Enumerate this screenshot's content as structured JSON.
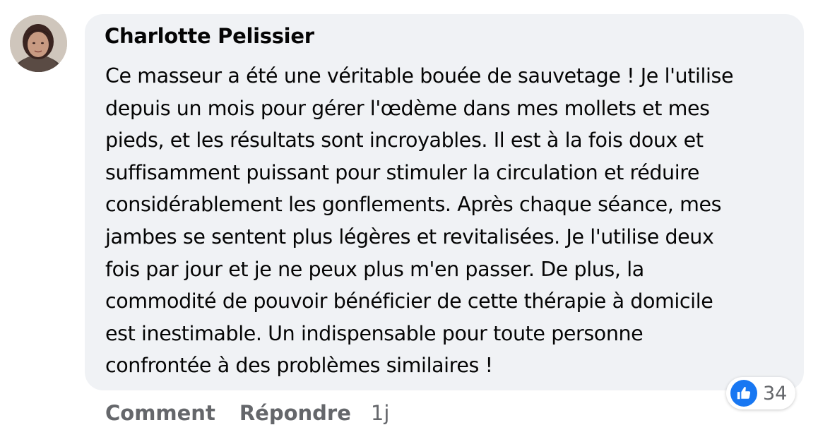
{
  "comment": {
    "author": "Charlotte Pelissier",
    "avatar_icon": "profile-photo",
    "lines": [
      "Ce masseur a été une véritable bouée de sauvetage ! Je l'utilise",
      "depuis un mois pour gérer l'œdème dans mes mollets et mes",
      "pieds, et les résultats sont incroyables. Il est à la fois doux et",
      "suffisamment puissant pour stimuler la circulation et réduire",
      "considérablement les gonflements. Après chaque séance, mes",
      "jambes se sentent plus légères et revitalisées. Je l'utilise deux",
      "fois par jour et je ne peux plus m'en passer. De plus, la",
      "commodité de pouvoir bénéficier de cette thérapie à domicile",
      "est inestimable. Un indispensable pour toute personne",
      "confrontée à des problèmes similaires !"
    ],
    "reactions": {
      "icon": "like-icon",
      "count": "34",
      "color": "#1877f2"
    },
    "actions": {
      "comment_label": "Comment",
      "reply_label": "Répondre",
      "timestamp": "1j"
    }
  }
}
